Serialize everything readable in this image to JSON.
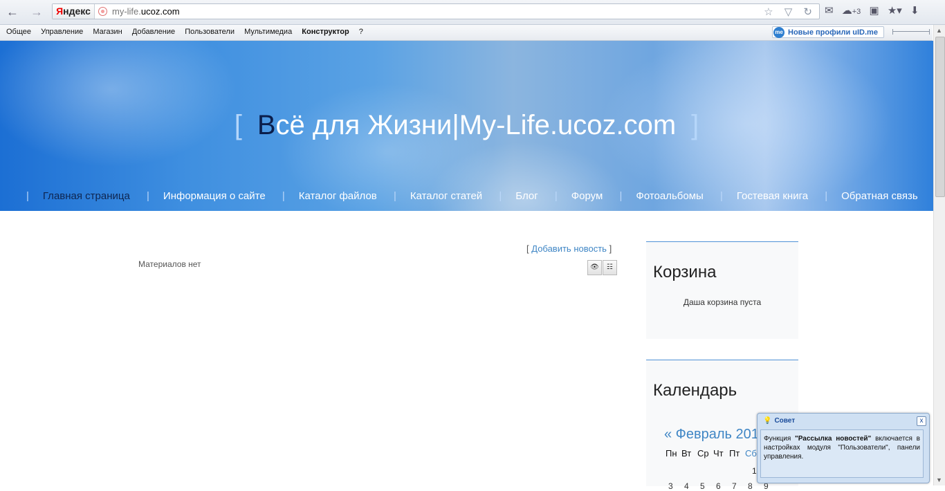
{
  "browser": {
    "back": "←",
    "forward": "→",
    "yandex_logo": "Яндекс",
    "url_prefix": "my-life.",
    "url_domain": "ucoz.com",
    "url_actions": "☆ ▽ ↻",
    "icons": [
      "mail-icon",
      "weather-icon",
      "bookmark-icon",
      "favorites-icon",
      "download-icon"
    ],
    "weather_badge": "+3"
  },
  "admin_bar": {
    "items": [
      "Общее",
      "Управление",
      "Магазин",
      "Добавление",
      "Пользователи",
      "Мультимедиа",
      "Конструктор",
      "?"
    ],
    "uid_logo": "me",
    "uid_label": "Новые профили uID.me"
  },
  "header": {
    "title_open": "[",
    "title_first_letter": "В",
    "title_rest": "сё для Жизни|My-Life.ucoz.com",
    "title_close": "]",
    "nav": [
      "Главная страница",
      "Информация о сайте",
      "Каталог файлов",
      "Каталог статей",
      "Блог",
      "Форум",
      "Фотоальбомы",
      "Гостевая книга",
      "Обратная связь"
    ]
  },
  "content": {
    "add_news_open": "[",
    "add_news": "Добавить новость",
    "add_news_close": "]",
    "no_materials": "Материалов нет"
  },
  "sidebar": {
    "cart_title": "Корзина",
    "cart_empty": "Даша корзина пуста",
    "calendar_title": "Календарь",
    "calendar_month": "« Февраль 201",
    "weekdays": [
      "Пн",
      "Вт",
      "Ср",
      "Чт",
      "Пт",
      "Сб"
    ],
    "first_day": "1",
    "row2": [
      "3",
      "4",
      "5",
      "6",
      "7",
      "8",
      "9"
    ]
  },
  "tip": {
    "title": "Совет",
    "close": "x",
    "text_before": "Функция ",
    "text_bold": "\"Рассылка новостей\"",
    "text_after": " включается в настройках модуля \"Пользователи\", панели управления."
  },
  "colors": {
    "link": "#3f86c5",
    "header_blue": "#1c6fd4",
    "sidebar_border": "#4e90d6"
  }
}
